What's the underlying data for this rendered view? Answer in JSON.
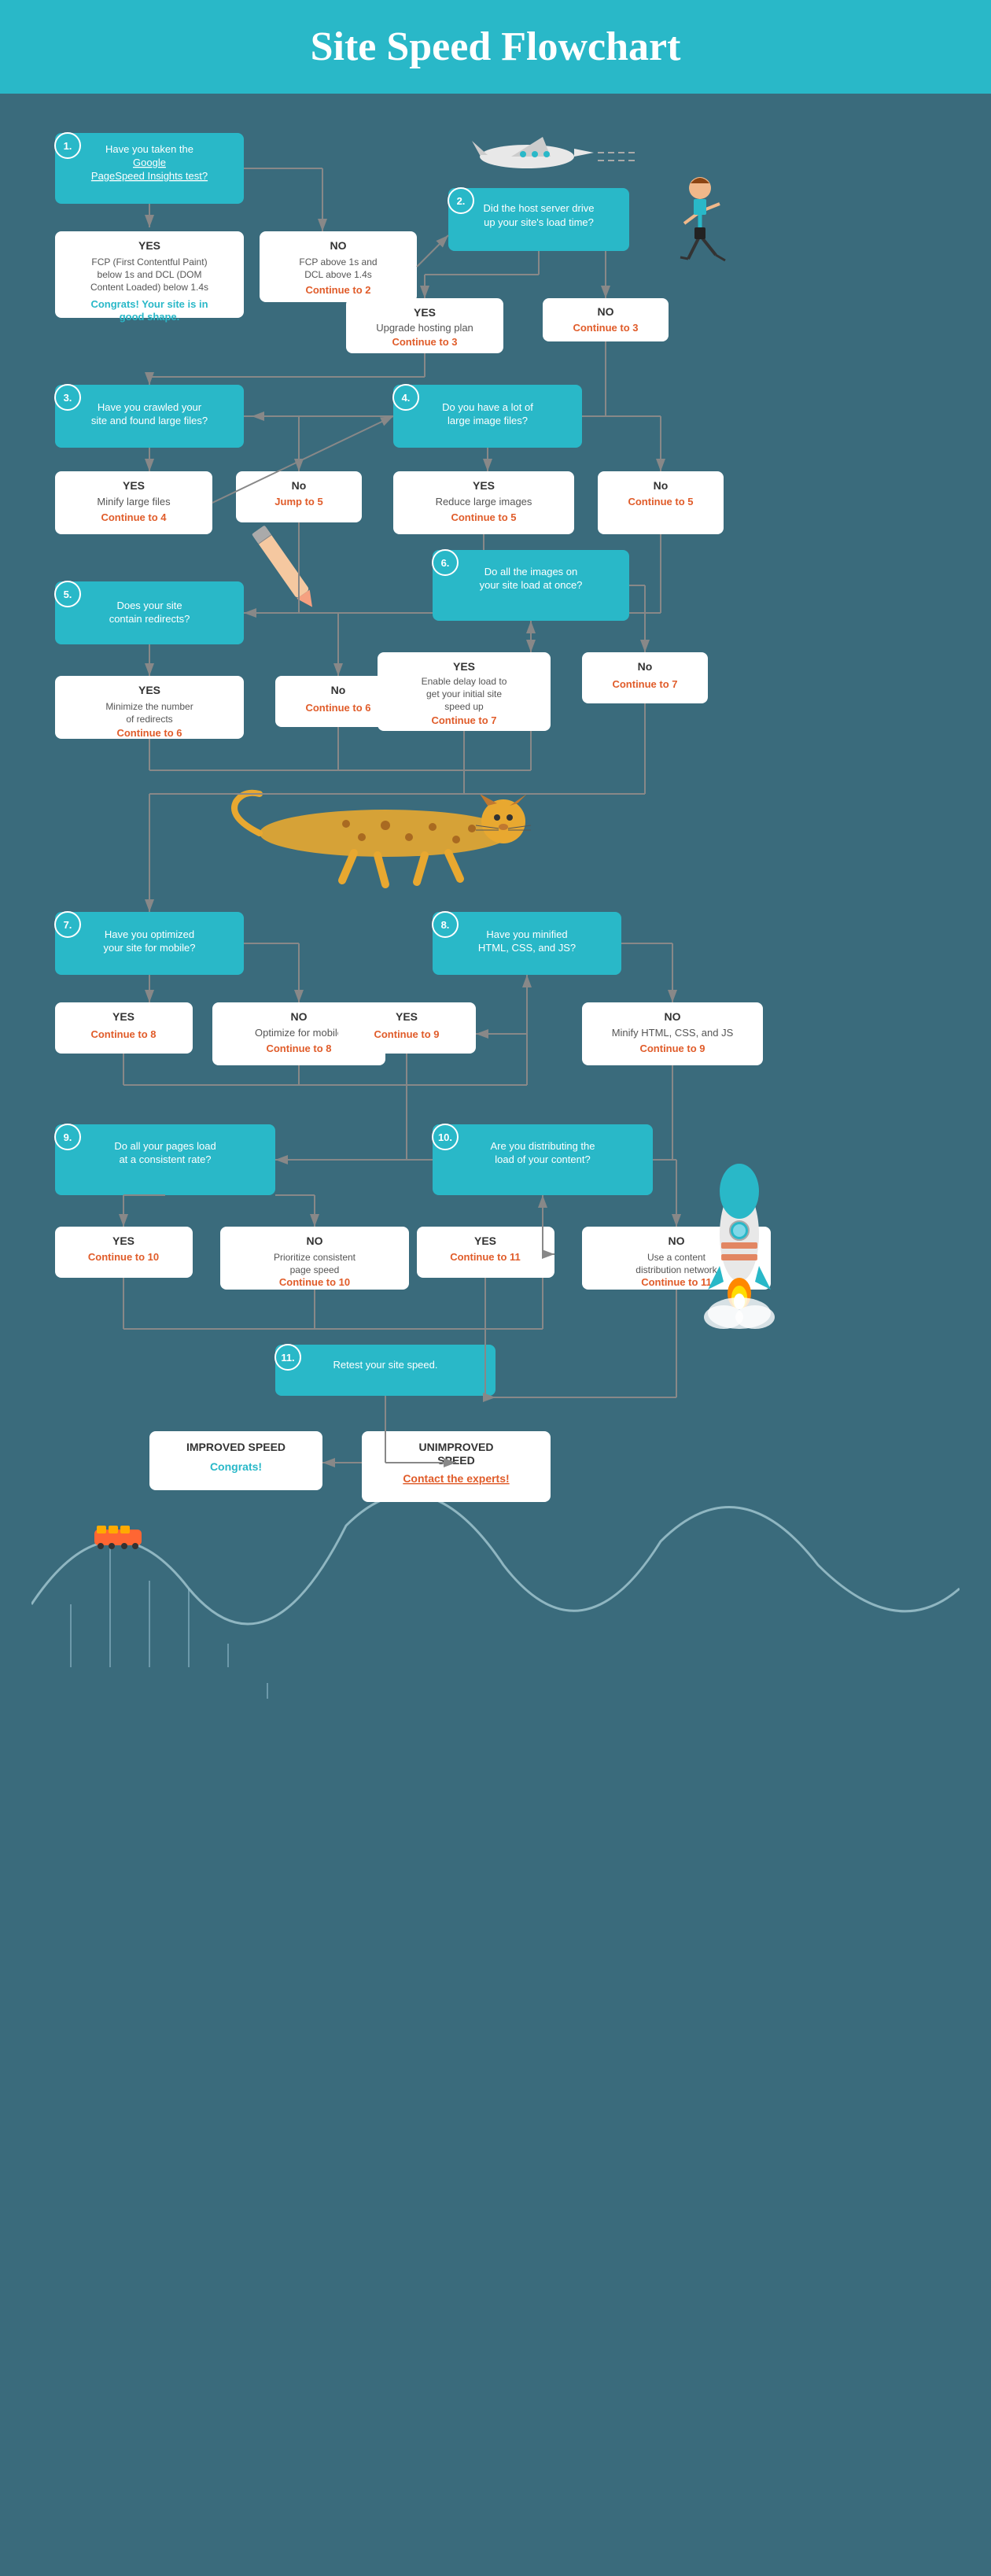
{
  "header": {
    "title": "Site Speed Flowchart"
  },
  "nodes": {
    "q1": {
      "number": "1.",
      "text": "Have you taken the Google PageSpeed Insights test?"
    },
    "q1_yes": {
      "label": "YES",
      "detail": "FCP (First Contentful Paint) below 1s and DCL (DOM Content Loaded) below 1.4s",
      "action": "Congrats! Your site is in good shape."
    },
    "q1_no": {
      "label": "NO",
      "detail": "FCP above 1s and DCL above 1.4s",
      "continue": "Continue to 2"
    },
    "q2": {
      "number": "2.",
      "text": "Did the host server drive up your site's load time?"
    },
    "q2_yes": {
      "label": "YES",
      "action": "Upgrade hosting plan",
      "continue": "Continue to 3"
    },
    "q2_no": {
      "label": "NO",
      "continue": "Continue to 3"
    },
    "q3": {
      "number": "3.",
      "text": "Have you crawled your site and found large files?"
    },
    "q3_yes": {
      "label": "YES",
      "action": "Minify large files",
      "continue": "Continue to 4"
    },
    "q3_no": {
      "label": "No",
      "continue": "Jump to 5"
    },
    "q4": {
      "number": "4.",
      "text": "Do you have a lot of large image files?"
    },
    "q4_yes": {
      "label": "YES",
      "action": "Reduce large images",
      "continue": "Continue to 5"
    },
    "q4_no": {
      "label": "No",
      "continue": "Continue to 5"
    },
    "q5": {
      "number": "5.",
      "text": "Does your site contain redirects?"
    },
    "q5_yes": {
      "label": "YES",
      "action": "Minimize the number of redirects",
      "continue": "Continue to 6"
    },
    "q5_no": {
      "label": "No",
      "continue": "Continue to 6"
    },
    "q6": {
      "number": "6.",
      "text": "Do all the images on your site load at once?"
    },
    "q6_yes": {
      "label": "YES",
      "action": "Enable delay load to get your initial site speed up",
      "continue": "Continue to 7"
    },
    "q6_no": {
      "label": "No",
      "continue": "Continue to 7"
    },
    "q7": {
      "number": "7.",
      "text": "Have you optimized your site for mobile?"
    },
    "q7_yes": {
      "label": "YES",
      "continue": "Continue to 8"
    },
    "q7_no": {
      "label": "NO",
      "action": "Optimize for mobile",
      "continue": "Continue to 8"
    },
    "q8": {
      "number": "8.",
      "text": "Have you minified HTML, CSS, and JS?"
    },
    "q8_yes": {
      "label": "YES",
      "continue": "Continue to 9"
    },
    "q8_no": {
      "label": "NO",
      "action": "Minify HTML, CSS, and JS",
      "continue": "Continue to 9"
    },
    "q9": {
      "number": "9.",
      "text": "Do all your pages load at a consistent rate?"
    },
    "q9_yes": {
      "label": "YES",
      "continue": "Continue to 10"
    },
    "q9_no": {
      "label": "NO",
      "action": "Prioritize consistent page speed",
      "continue": "Continue to 10"
    },
    "q10": {
      "number": "10.",
      "text": "Are you distributing the load of your content?"
    },
    "q10_yes": {
      "label": "YES",
      "continue": "Continue to 11"
    },
    "q10_no": {
      "label": "NO",
      "action": "Use a content distribution network",
      "continue": "Continue to 11"
    },
    "q11": {
      "number": "11.",
      "text": "Retest your site speed."
    },
    "end_improved": {
      "label": "IMPROVED SPEED",
      "action": "Congrats!"
    },
    "end_unimproved": {
      "label": "UNIMPROVED SPEED",
      "action": "Contact the experts!"
    }
  }
}
